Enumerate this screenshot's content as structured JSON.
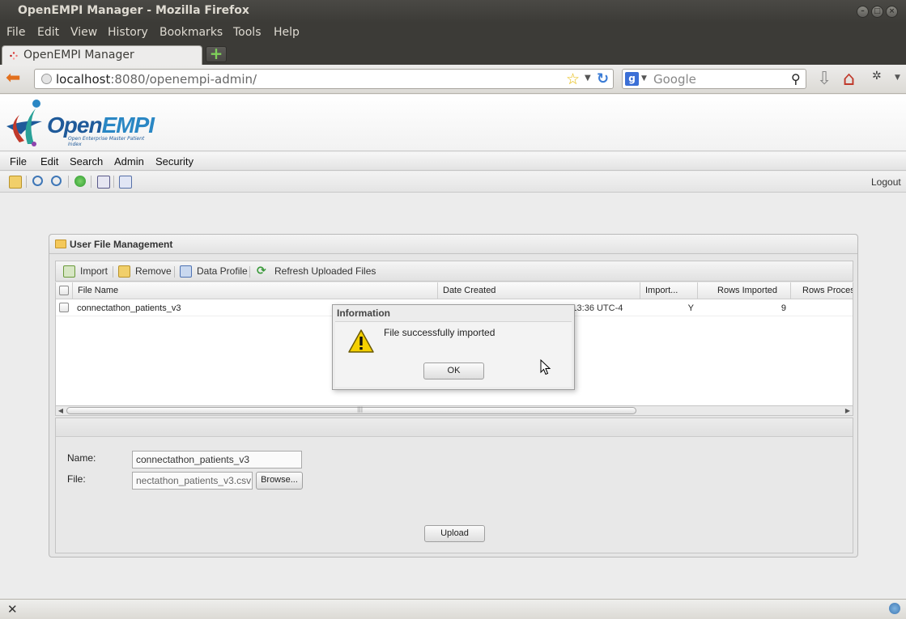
{
  "window": {
    "title": "OpenEMPI Manager - Mozilla Firefox",
    "controls": [
      "minimize",
      "maximize",
      "close"
    ]
  },
  "firefox_menu": [
    "File",
    "Edit",
    "View",
    "History",
    "Bookmarks",
    "Tools",
    "Help"
  ],
  "tabs": [
    {
      "label": "OpenEMPI Manager"
    }
  ],
  "navbar": {
    "url_host": "localhost",
    "url_rest": ":8080/openempi-admin/",
    "search_placeholder": "Google"
  },
  "logo": {
    "name": "Open",
    "name_accent": "EMPI",
    "tagline": "Open Enterprise Master Patient Index"
  },
  "app_menu": [
    "File",
    "Edit",
    "Search",
    "Admin",
    "Security"
  ],
  "app_toolbar": {
    "logout": "Logout"
  },
  "panel": {
    "title": "User File Management",
    "toolbar": {
      "import": "Import",
      "remove": "Remove",
      "data_profile": "Data Profile",
      "refresh": "Refresh Uploaded Files"
    },
    "grid": {
      "columns": [
        "File Name",
        "Date Created",
        "Import...",
        "Rows Imported",
        "Rows Proces"
      ],
      "rows": [
        {
          "file_name": "connectathon_patients_v3",
          "date_created": "Monday, 2013 September 09 12:13:36 UTC-4",
          "imported": "Y",
          "rows_imported": "9",
          "rows_processed": ""
        }
      ]
    },
    "form": {
      "name_label": "Name:",
      "name_value": "connectathon_patients_v3",
      "file_label": "File:",
      "file_value": "nectathon_patients_v3.csv",
      "browse": "Browse...",
      "upload": "Upload"
    }
  },
  "dialog": {
    "title": "Information",
    "message": "File successfully imported",
    "ok": "OK"
  },
  "colors": {
    "ubuntu_chrome": "#3c3b37",
    "logo_blue": "#1f5a9a",
    "back_arrow": "#e2701e",
    "warning_yellow": "#f5d000"
  }
}
